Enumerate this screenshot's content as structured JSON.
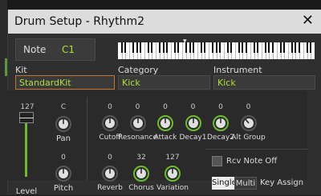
{
  "dialog": {
    "title": "Drum Setup - Rhythm2",
    "close_icon": "close-icon"
  },
  "note": {
    "label": "Note",
    "value": "C1"
  },
  "kit": {
    "label": "Kit",
    "value": "StandardKit"
  },
  "category": {
    "label": "Category",
    "value": "Kick"
  },
  "instrument": {
    "label": "Instrument",
    "value": "Kick"
  },
  "level": {
    "value": "127",
    "label": "Level"
  },
  "pan": {
    "value": "C",
    "label": "Pan"
  },
  "pitch": {
    "value": "0",
    "label": "Pitch"
  },
  "params": [
    {
      "value": "0",
      "label": "Cutoff"
    },
    {
      "value": "0",
      "label": "Resonance"
    },
    {
      "value": "0",
      "label": "Attack"
    },
    {
      "value": "0",
      "label": "Decay1"
    },
    {
      "value": "0",
      "label": "Decay2"
    },
    {
      "value": "0",
      "label": "Alt Group"
    }
  ],
  "effects": [
    {
      "value": "0",
      "label": "Reverb"
    },
    {
      "value": "32",
      "label": "Chorus"
    },
    {
      "value": "127",
      "label": "Variation"
    }
  ],
  "rcv_note_off": {
    "label": "Rcv Note Off",
    "checked": false
  },
  "key_assign": {
    "single": "Single",
    "multi": "Multi",
    "label": "Key Assign",
    "selected": "Single"
  },
  "colors": {
    "accent": "#aee03a",
    "knob_active": "#6abd2a",
    "kit_border": "#c77432"
  }
}
